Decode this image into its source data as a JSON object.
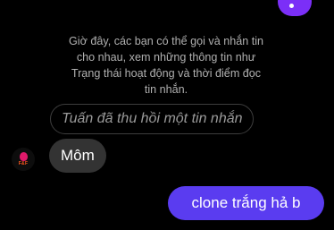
{
  "chat": {
    "notice_text": "Giờ đây, các bạn có thể gọi và nhắn tin\ncho nhau, xem những thông tin như\nTrạng thái hoạt động và thời điểm đọc\ntin nhắn.",
    "unsent_message": "Tuấn đã thu hồi một tin nhắn",
    "incoming_message": "Môm",
    "outgoing_message": "clone trắng hả b",
    "avatar_logo_text": "F&F"
  },
  "colors": {
    "background": "#000000",
    "incoming_bubble": "#333333",
    "outgoing_bubble": "#5a3cf0",
    "top_bubble": "#7b2ff7"
  }
}
